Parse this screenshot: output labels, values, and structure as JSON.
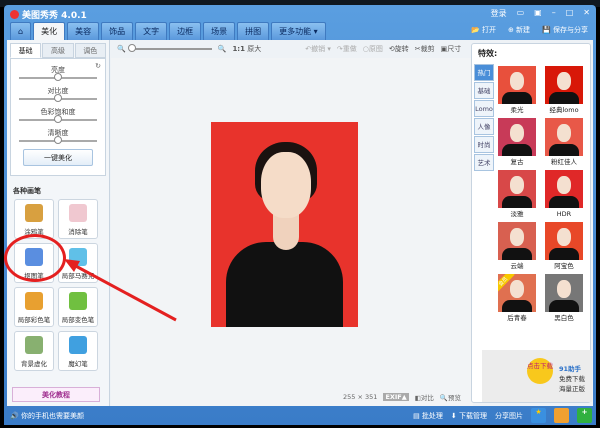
{
  "app": {
    "title": "美图秀秀 4.0.1",
    "login": "登录"
  },
  "tabs": [
    {
      "label": "美化",
      "active": true
    },
    {
      "label": "美容"
    },
    {
      "label": "饰品"
    },
    {
      "label": "文字"
    },
    {
      "label": "边框"
    },
    {
      "label": "场景"
    },
    {
      "label": "拼图"
    },
    {
      "label": "更多功能 ▾"
    }
  ],
  "tools": {
    "open": "打开",
    "new": "新建",
    "save": "保存与分享"
  },
  "left": {
    "subtabs": [
      "基础",
      "高级",
      "调色"
    ],
    "sliders": [
      "亮度",
      "对比度",
      "色彩饱和度",
      "清晰度"
    ],
    "one_key": "一键美化",
    "brush_section": "各种画笔",
    "brushes": [
      {
        "label": "涂鸦笔",
        "badge": "升级"
      },
      {
        "label": "消除笔"
      },
      {
        "label": "抠图笔"
      },
      {
        "label": "局部马赛克"
      },
      {
        "label": "局部彩色笔"
      },
      {
        "label": "局部变色笔"
      },
      {
        "label": "背景虚化"
      },
      {
        "label": "魔幻笔",
        "badge": "new"
      }
    ],
    "tutorial": "美化教程"
  },
  "canvas_toolbar": {
    "zoom_11": "1:1",
    "original_size": "原大",
    "undo": "撤销",
    "redo": "重做",
    "original": "原图",
    "rotate": "旋转",
    "crop": "裁剪",
    "size": "尺寸"
  },
  "status": {
    "dimensions": "255 × 351",
    "exif": "EXIF▲",
    "compare": "对比",
    "preview": "预览"
  },
  "effects": {
    "title": "特效:",
    "tabs": [
      "热门",
      "基础",
      "Lomo",
      "人像",
      "时尚",
      "艺术"
    ],
    "items": [
      {
        "label": "柔光",
        "bg": "#e8503c"
      },
      {
        "label": "经典lomo",
        "bg": "#d81808"
      },
      {
        "label": "复古",
        "bg": "#c83a58"
      },
      {
        "label": "粉红佳人",
        "bg": "#e85848"
      },
      {
        "label": "淡雅",
        "bg": "#d84848"
      },
      {
        "label": "HDR",
        "bg": "#e02828"
      },
      {
        "label": "云端",
        "bg": "#d86050"
      },
      {
        "label": "阿宝色",
        "bg": "#e84828"
      },
      {
        "label": "后青春",
        "bg": "#e07050",
        "badge": "会员"
      },
      {
        "label": "黑白色",
        "bg": "#777777"
      }
    ]
  },
  "ad": {
    "button": "点击下载",
    "brand": "91助手",
    "line1": "免费下载",
    "line2": "海量正版"
  },
  "bottom": {
    "phone_tip": "你的手机也需要美颜",
    "batch": "批处理",
    "downloads": "下载管理",
    "share": "分享图片"
  },
  "colors": {
    "accent": "#3a7cc8",
    "highlight": "#e42020"
  }
}
